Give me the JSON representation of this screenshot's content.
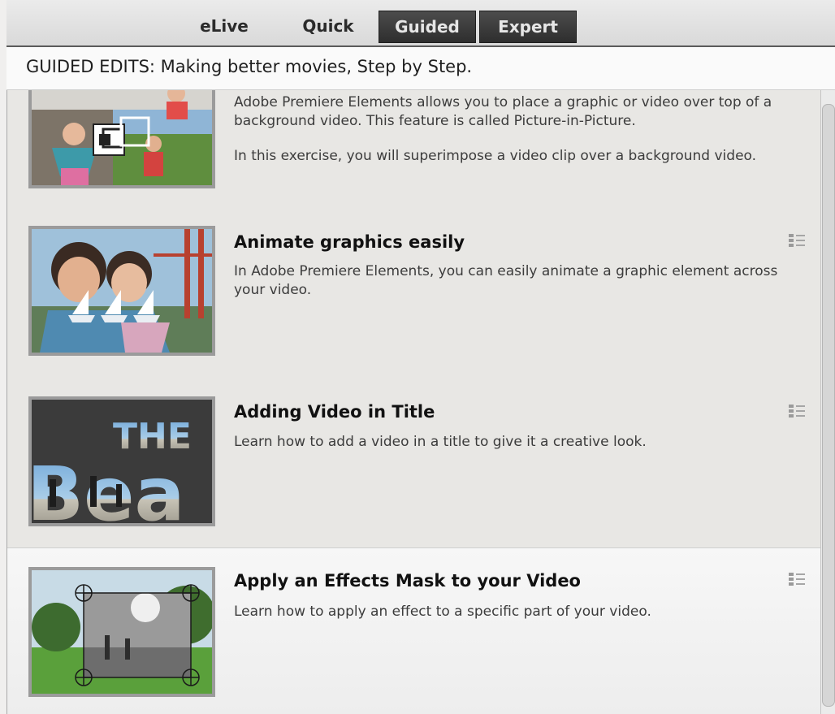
{
  "mode_bar": {
    "tabs": [
      {
        "label": "eLive"
      },
      {
        "label": "Quick"
      },
      {
        "label": "Guided"
      },
      {
        "label": "Expert"
      }
    ]
  },
  "header": {
    "title": "GUIDED EDITS: Making better movies, Step by Step."
  },
  "items": [
    {
      "title": "",
      "description": [
        "Adobe Premiere Elements allows you to place a graphic or video over top of a background video. This feature is called Picture-in-Picture.",
        "In this exercise, you will superimpose a video clip over a background video."
      ],
      "thumbnail_icon": "picture-in-picture-icon"
    },
    {
      "title": "Animate graphics easily",
      "description": [
        "In Adobe Premiere Elements, you can easily animate a graphic element across your video."
      ],
      "thumbnail_icon": "sailboat-icon"
    },
    {
      "title": "Adding Video in Title",
      "description": [
        "Learn how to add a video in a title to give it a creative look."
      ],
      "thumbnail_text": "THE Bea"
    },
    {
      "title": "Apply an Effects Mask to your Video",
      "description": [
        "Learn how to apply an effect to a specific part of your video."
      ],
      "thumbnail_icon": "mask-handles-icon"
    }
  ],
  "icons": {
    "item_menu": "list-icon"
  },
  "colors": {
    "tab_dark": "#3a3a3a",
    "highlight_row": "#f3f3f3",
    "thumb_border": "#9b9b9b"
  }
}
